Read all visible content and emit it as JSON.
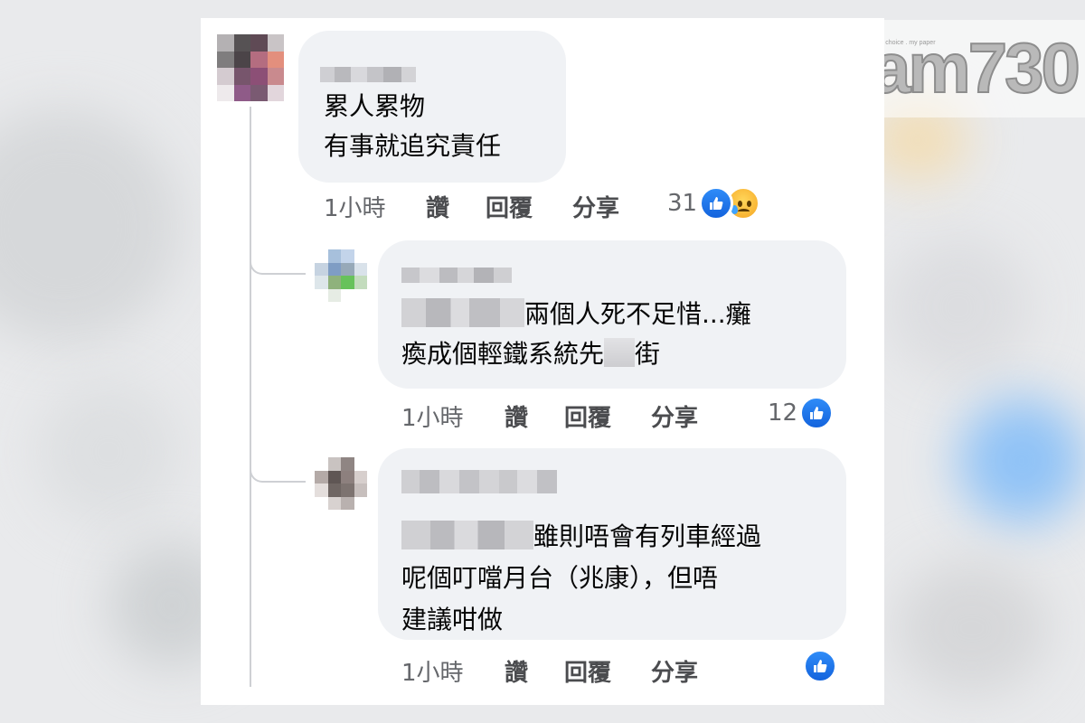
{
  "logo": {
    "tagline": "my choice . my paper",
    "text": "am730"
  },
  "comments": [
    {
      "text_lines": [
        "累人累物",
        "有事就追究責任"
      ],
      "time": "1小時",
      "like_label": "讚",
      "reply_label": "回覆",
      "share_label": "分享",
      "reaction_count": "31",
      "reactions": [
        "like-icon",
        "sad-icon"
      ]
    },
    {
      "line1_visible": "兩個人死不足惜...癱",
      "line2_before": "瘓成個輕鐵系統先",
      "line2_after": "街",
      "time": "1小時",
      "like_label": "讚",
      "reply_label": "回覆",
      "share_label": "分享",
      "reaction_count": "12",
      "reactions": [
        "like-icon"
      ]
    },
    {
      "line1_visible": "雖則唔會有列車經過",
      "line2": "呢個叮噹月台（兆康），但唔",
      "line3": "建議咁做",
      "time": "1小時",
      "like_label": "讚",
      "reply_label": "回覆",
      "share_label": "分享",
      "reaction_count": "",
      "reactions": [
        "like-icon"
      ]
    }
  ],
  "colors": {
    "bubble": "#f0f2f5",
    "meta_text": "#65676b",
    "like_blue": "#1877f2"
  }
}
